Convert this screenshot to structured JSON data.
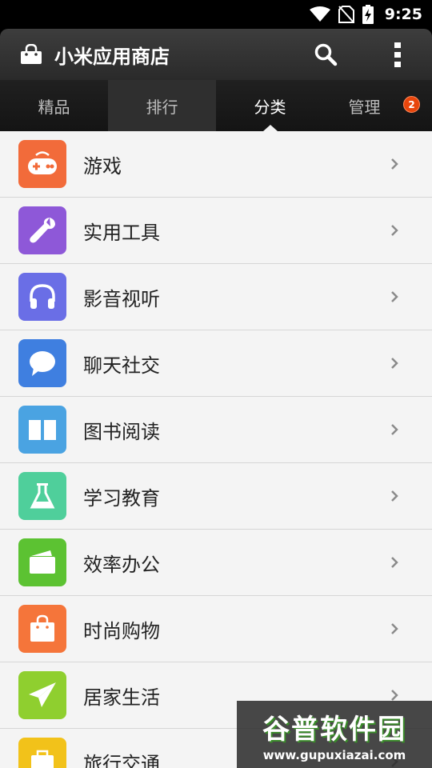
{
  "status": {
    "time": "9:25",
    "icons": [
      "wifi-icon",
      "no-sim-icon",
      "battery-charging-icon"
    ]
  },
  "app": {
    "title": "小米应用商店",
    "logo_icon": "shopping-bag-icon",
    "search_icon": "search-icon",
    "more_icon": "overflow-menu-icon"
  },
  "tabs": [
    {
      "label": "精品"
    },
    {
      "label": "排行"
    },
    {
      "label": "分类"
    },
    {
      "label": "管理",
      "badge": "2"
    }
  ],
  "categories": [
    {
      "label": "游戏",
      "icon": "gamepad-icon",
      "color": "#f26b3a"
    },
    {
      "label": "实用工具",
      "icon": "wrench-icon",
      "color": "#8e58d8"
    },
    {
      "label": "影音视听",
      "icon": "headphones-icon",
      "color": "#6a6ee6"
    },
    {
      "label": "聊天社交",
      "icon": "chat-bubble-icon",
      "color": "#3f7fe0"
    },
    {
      "label": "图书阅读",
      "icon": "book-icon",
      "color": "#4aa3e2"
    },
    {
      "label": "学习教育",
      "icon": "flask-icon",
      "color": "#4fcf9b"
    },
    {
      "label": "效率办公",
      "icon": "folder-icon",
      "color": "#5cc232"
    },
    {
      "label": "时尚购物",
      "icon": "shopping-bag-icon",
      "color": "#f5753a"
    },
    {
      "label": "居家生活",
      "icon": "paper-plane-icon",
      "color": "#8fcf2f"
    },
    {
      "label": "旅行交通",
      "icon": "luggage-icon",
      "color": "#f2c21a"
    }
  ],
  "watermark": {
    "title": "谷普软件园",
    "url": "www.gupuxiazai.com"
  }
}
